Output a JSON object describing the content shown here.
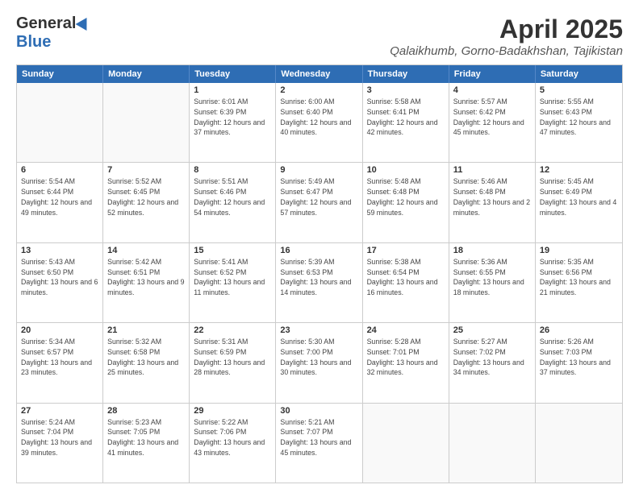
{
  "header": {
    "logo_general": "General",
    "logo_blue": "Blue",
    "month": "April 2025",
    "location": "Qalaikhumb, Gorno-Badakhshan, Tajikistan"
  },
  "weekdays": [
    "Sunday",
    "Monday",
    "Tuesday",
    "Wednesday",
    "Thursday",
    "Friday",
    "Saturday"
  ],
  "rows": [
    [
      {
        "day": "",
        "info": ""
      },
      {
        "day": "",
        "info": ""
      },
      {
        "day": "1",
        "info": "Sunrise: 6:01 AM\nSunset: 6:39 PM\nDaylight: 12 hours and 37 minutes."
      },
      {
        "day": "2",
        "info": "Sunrise: 6:00 AM\nSunset: 6:40 PM\nDaylight: 12 hours and 40 minutes."
      },
      {
        "day": "3",
        "info": "Sunrise: 5:58 AM\nSunset: 6:41 PM\nDaylight: 12 hours and 42 minutes."
      },
      {
        "day": "4",
        "info": "Sunrise: 5:57 AM\nSunset: 6:42 PM\nDaylight: 12 hours and 45 minutes."
      },
      {
        "day": "5",
        "info": "Sunrise: 5:55 AM\nSunset: 6:43 PM\nDaylight: 12 hours and 47 minutes."
      }
    ],
    [
      {
        "day": "6",
        "info": "Sunrise: 5:54 AM\nSunset: 6:44 PM\nDaylight: 12 hours and 49 minutes."
      },
      {
        "day": "7",
        "info": "Sunrise: 5:52 AM\nSunset: 6:45 PM\nDaylight: 12 hours and 52 minutes."
      },
      {
        "day": "8",
        "info": "Sunrise: 5:51 AM\nSunset: 6:46 PM\nDaylight: 12 hours and 54 minutes."
      },
      {
        "day": "9",
        "info": "Sunrise: 5:49 AM\nSunset: 6:47 PM\nDaylight: 12 hours and 57 minutes."
      },
      {
        "day": "10",
        "info": "Sunrise: 5:48 AM\nSunset: 6:48 PM\nDaylight: 12 hours and 59 minutes."
      },
      {
        "day": "11",
        "info": "Sunrise: 5:46 AM\nSunset: 6:48 PM\nDaylight: 13 hours and 2 minutes."
      },
      {
        "day": "12",
        "info": "Sunrise: 5:45 AM\nSunset: 6:49 PM\nDaylight: 13 hours and 4 minutes."
      }
    ],
    [
      {
        "day": "13",
        "info": "Sunrise: 5:43 AM\nSunset: 6:50 PM\nDaylight: 13 hours and 6 minutes."
      },
      {
        "day": "14",
        "info": "Sunrise: 5:42 AM\nSunset: 6:51 PM\nDaylight: 13 hours and 9 minutes."
      },
      {
        "day": "15",
        "info": "Sunrise: 5:41 AM\nSunset: 6:52 PM\nDaylight: 13 hours and 11 minutes."
      },
      {
        "day": "16",
        "info": "Sunrise: 5:39 AM\nSunset: 6:53 PM\nDaylight: 13 hours and 14 minutes."
      },
      {
        "day": "17",
        "info": "Sunrise: 5:38 AM\nSunset: 6:54 PM\nDaylight: 13 hours and 16 minutes."
      },
      {
        "day": "18",
        "info": "Sunrise: 5:36 AM\nSunset: 6:55 PM\nDaylight: 13 hours and 18 minutes."
      },
      {
        "day": "19",
        "info": "Sunrise: 5:35 AM\nSunset: 6:56 PM\nDaylight: 13 hours and 21 minutes."
      }
    ],
    [
      {
        "day": "20",
        "info": "Sunrise: 5:34 AM\nSunset: 6:57 PM\nDaylight: 13 hours and 23 minutes."
      },
      {
        "day": "21",
        "info": "Sunrise: 5:32 AM\nSunset: 6:58 PM\nDaylight: 13 hours and 25 minutes."
      },
      {
        "day": "22",
        "info": "Sunrise: 5:31 AM\nSunset: 6:59 PM\nDaylight: 13 hours and 28 minutes."
      },
      {
        "day": "23",
        "info": "Sunrise: 5:30 AM\nSunset: 7:00 PM\nDaylight: 13 hours and 30 minutes."
      },
      {
        "day": "24",
        "info": "Sunrise: 5:28 AM\nSunset: 7:01 PM\nDaylight: 13 hours and 32 minutes."
      },
      {
        "day": "25",
        "info": "Sunrise: 5:27 AM\nSunset: 7:02 PM\nDaylight: 13 hours and 34 minutes."
      },
      {
        "day": "26",
        "info": "Sunrise: 5:26 AM\nSunset: 7:03 PM\nDaylight: 13 hours and 37 minutes."
      }
    ],
    [
      {
        "day": "27",
        "info": "Sunrise: 5:24 AM\nSunset: 7:04 PM\nDaylight: 13 hours and 39 minutes."
      },
      {
        "day": "28",
        "info": "Sunrise: 5:23 AM\nSunset: 7:05 PM\nDaylight: 13 hours and 41 minutes."
      },
      {
        "day": "29",
        "info": "Sunrise: 5:22 AM\nSunset: 7:06 PM\nDaylight: 13 hours and 43 minutes."
      },
      {
        "day": "30",
        "info": "Sunrise: 5:21 AM\nSunset: 7:07 PM\nDaylight: 13 hours and 45 minutes."
      },
      {
        "day": "",
        "info": ""
      },
      {
        "day": "",
        "info": ""
      },
      {
        "day": "",
        "info": ""
      }
    ]
  ]
}
